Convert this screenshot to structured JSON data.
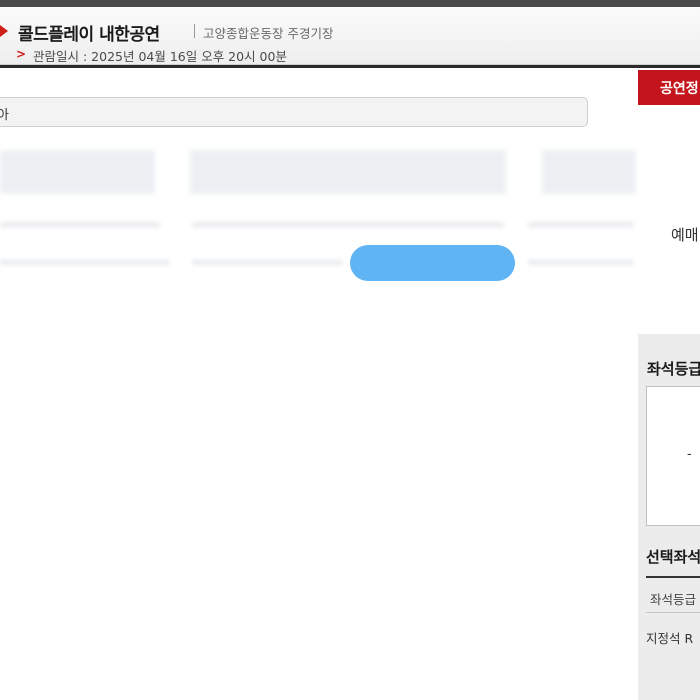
{
  "header": {
    "title": "콜드플레이 내한공연",
    "venue": "고양종합운동장 주경기장",
    "datetime_label": "관람일시 : 2025년 04월 16일 오후 20시 00분"
  },
  "search": {
    "visible_text": "아"
  },
  "right": {
    "tab_label": "공연정",
    "cut_text": "예매",
    "panel": {
      "seat_grade_heading": "좌석등급",
      "seat_grade_value": "-",
      "selected_heading": "선택좌석",
      "column_header": "좌석등급",
      "row_text": "지정석 R"
    }
  },
  "colors": {
    "accent_red": "#c4151c",
    "button_blue": "#5fb4f4"
  },
  "icons": {
    "header_arrow": "red-triangle-icon",
    "date_chevron": "chevron-right-icon"
  }
}
